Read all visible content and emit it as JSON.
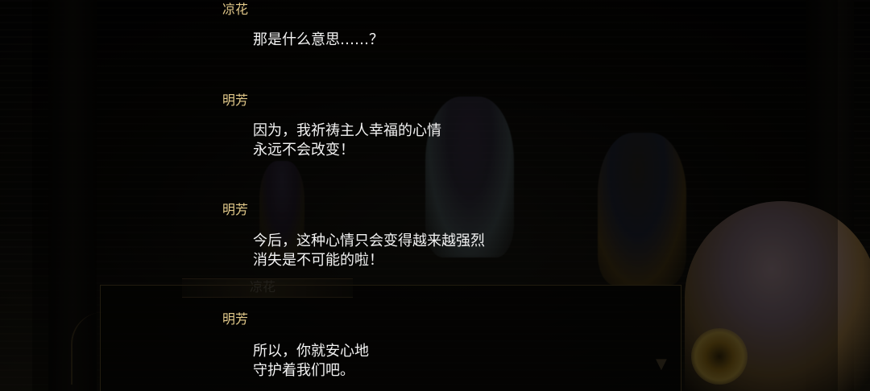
{
  "background": {
    "nameplate_name": "凉花",
    "advance_icon": "chevron-down-icon"
  },
  "log": [
    {
      "speaker": "凉花",
      "lines": [
        "那是什么意思……？"
      ]
    },
    {
      "speaker": "明芳",
      "lines": [
        "因为，我祈祷主人幸福的心情",
        "永远不会改变！"
      ]
    },
    {
      "speaker": "明芳",
      "lines": [
        "今后，这种心情只会变得越来越强烈",
        "消失是不可能的啦！"
      ]
    },
    {
      "speaker": "明芳",
      "lines": [
        "所以，你就安心地",
        "守护着我们吧。"
      ]
    }
  ],
  "colors": {
    "speaker": "#e2c98a",
    "text": "#f2f2f2",
    "frame": "#6e5a33"
  }
}
